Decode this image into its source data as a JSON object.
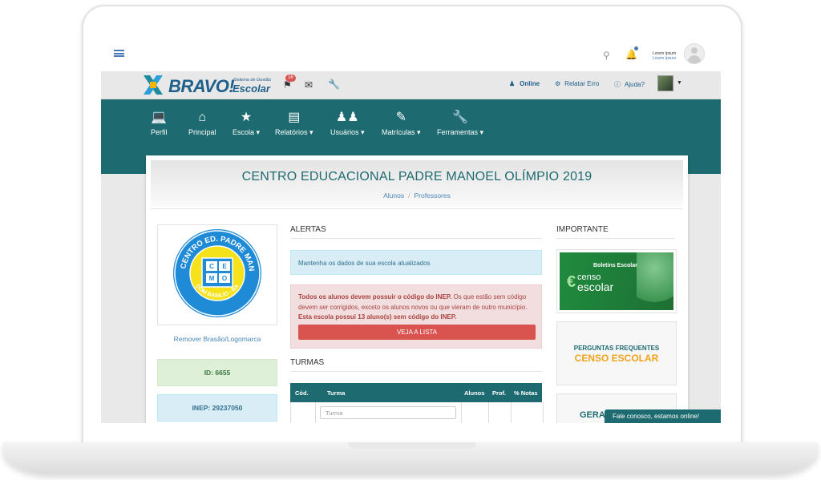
{
  "os": {
    "user_name": "Lorem Ipsum",
    "user_sub": "Lorem Ipsum"
  },
  "topbar": {
    "brand": "BRAVO!",
    "brand_sub1": "Sistema de Gestão",
    "brand_sub2": "Escolar",
    "badge_count": "16",
    "online_label": "Online",
    "report_label": "Relatar Erro",
    "help_label": "Ajuda?"
  },
  "nav": {
    "items": [
      {
        "label": "Perfil"
      },
      {
        "label": "Principal"
      },
      {
        "label": "Escola ▾"
      },
      {
        "label": "Relatórios ▾"
      },
      {
        "label": "Usuários ▾"
      },
      {
        "label": "Matrículas ▾"
      },
      {
        "label": "Ferramentas ▾"
      }
    ]
  },
  "header": {
    "title": "CENTRO EDUCACIONAL PADRE MANOEL OLÍMPIO 2019",
    "crumb1": "Alunos",
    "crumb_sep": "/",
    "crumb2": "Professores"
  },
  "crest": {
    "ring_text": "CENTRO ED. PADRE MANOEL OLIMPIO",
    "bottom_text": "DOM BASILIO - BA",
    "letters": [
      "C",
      "E",
      "M",
      "O"
    ]
  },
  "left": {
    "remove_link": "Remover Brasão/Logomarca",
    "id_label": "ID: 6655",
    "inep_label": "INEP: 29237050"
  },
  "alerts": {
    "title": "ALERTAS",
    "info": "Mantenha os dados de sua escola atualizados",
    "danger_bold1": "Todos os alunos devem possuir o código do INEP.",
    "danger_text": " Os que estão sem código devem ser corrigidos, exceto os alunos novos ou que vieram de outro município. ",
    "danger_bold2": "Esta escola possui 13 aluno(s) sem código do INEP.",
    "button": "VEJA A LISTA"
  },
  "turmas": {
    "title": "TURMAS",
    "columns": [
      "Cód.",
      "Turma",
      "Alunos",
      "Prof.",
      "% Notas"
    ],
    "filter_placeholder": "Turma"
  },
  "important": {
    "title": "IMPORTANTE",
    "banner1_title": "Boletins Escolar",
    "banner1_line1": "censo",
    "banner1_line2": "escolar",
    "banner2_line1": "PERGUNTAS FREQUENTES",
    "banner2_line2": "CENSO ESCOLAR",
    "banner3_text": "GERA"
  },
  "chat": {
    "label": "Fale conosco, estamos online!"
  },
  "colors": {
    "primary": "#1d6b70",
    "brand_blue": "#1f5f8b",
    "danger": "#d9534f"
  }
}
